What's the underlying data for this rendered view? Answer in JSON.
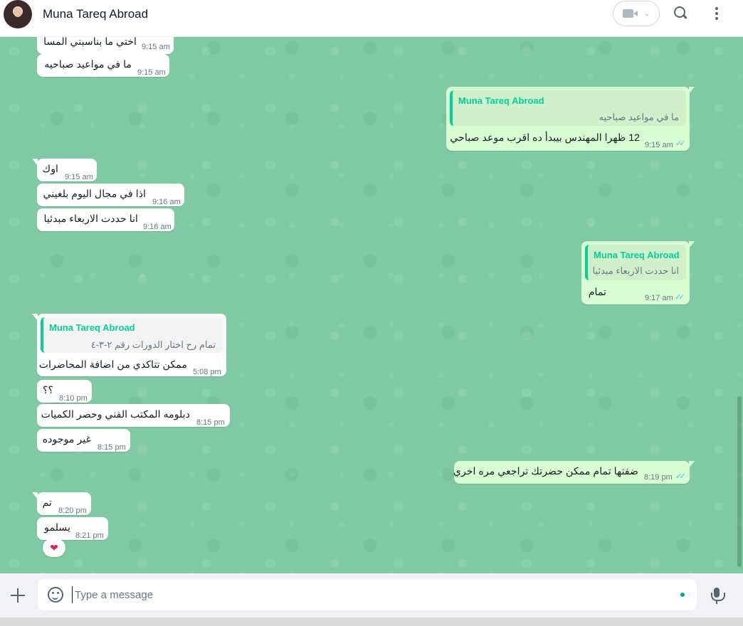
{
  "header": {
    "title": "Muna Tareq Abroad",
    "video_icon": "video-call-icon",
    "search_icon": "search-icon",
    "menu_icon": "menu-icon"
  },
  "messages": [
    {
      "dir": "in",
      "text": "اختي ما بناسبني المسا",
      "time": "9:15 am"
    },
    {
      "dir": "in",
      "text": "ما في مواعيد صباحيه",
      "time": "9:15 am"
    },
    {
      "dir": "out",
      "quote_name": "Muna Tareq Abroad",
      "quote_text": "ما في مواعيد صباحيه",
      "text": "12 ظهرا المهندس بيبدأ ده اقرب موعد صباحي",
      "time": "9:15 am"
    },
    {
      "dir": "in",
      "text": "اوك",
      "time": "9:15 am"
    },
    {
      "dir": "in",
      "text": "اذا في مجال اليوم بلغيني",
      "time": "9:16 am"
    },
    {
      "dir": "in",
      "text": "انا حددت الاربعاء مبدئيا",
      "time": "9:16 am"
    },
    {
      "dir": "out",
      "quote_name": "Muna Tareq Abroad",
      "quote_text": "انا حددت الاربعاء مبدئيا",
      "text": "تمام",
      "time": "9:17 am"
    },
    {
      "dir": "in",
      "quote_name": "Muna Tareq Abroad",
      "quote_text": "تمام رح اختار الدورات رقم ٢-٣-٤",
      "text": "ممكن تتاكدي من اضافة المحاضرات",
      "time": "5:08 pm"
    },
    {
      "dir": "in",
      "text": "؟؟",
      "time": "8:10 pm"
    },
    {
      "dir": "in",
      "text": "دبلومه المكتب الفني وحصر الكميات",
      "time": "8:15 pm"
    },
    {
      "dir": "in",
      "text": "غير موجوده",
      "time": "8:15 pm"
    },
    {
      "dir": "out",
      "text": "ضفتها تمام ممكن حضرتك تراجعي مره اخري",
      "time": "8:19 pm"
    },
    {
      "dir": "in",
      "text": "تم",
      "time": "8:20 pm"
    },
    {
      "dir": "in",
      "text": "يسلمو",
      "time": "8:21 pm"
    }
  ],
  "reaction": "❤",
  "composer": {
    "placeholder": "Type a message",
    "attach_icon": "plus-icon",
    "sticker_icon": "sticker-icon",
    "mic_icon": "microphone-icon"
  },
  "colors": {
    "chat_background": "#7fcaa4",
    "outgoing_bubble": "#d9fdd3",
    "incoming_bubble": "#ffffff",
    "quote_accent": "#06cf9c",
    "read_ticks": "#53bdeb"
  }
}
